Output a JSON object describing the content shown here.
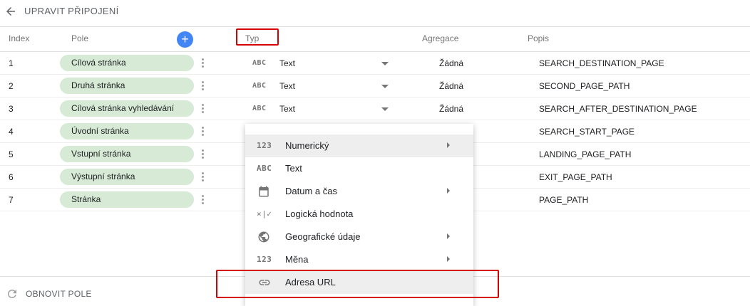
{
  "header": {
    "title": "UPRAVIT PŘIPOJENÍ"
  },
  "columns": {
    "index": "Index",
    "field": "Pole",
    "type": "Typ",
    "aggregation": "Agregace",
    "description": "Popis",
    "add_symbol": "+"
  },
  "rows": [
    {
      "index": "1",
      "field": "Cílová stránka",
      "type_icon": "ABC",
      "type": "Text",
      "aggregation": "Žádná",
      "description": "SEARCH_DESTINATION_PAGE"
    },
    {
      "index": "2",
      "field": "Druhá stránka",
      "type_icon": "ABC",
      "type": "Text",
      "aggregation": "Žádná",
      "description": "SECOND_PAGE_PATH"
    },
    {
      "index": "3",
      "field": "Cílová stránka vyhledávání",
      "type_icon": "ABC",
      "type": "Text",
      "aggregation": "Žádná",
      "description": "SEARCH_AFTER_DESTINATION_PAGE"
    },
    {
      "index": "4",
      "field": "Úvodní stránka",
      "description": "SEARCH_START_PAGE"
    },
    {
      "index": "5",
      "field": "Vstupní stránka",
      "description": "LANDING_PAGE_PATH"
    },
    {
      "index": "6",
      "field": "Výstupní stránka",
      "description": "EXIT_PAGE_PATH"
    },
    {
      "index": "7",
      "field": "Stránka",
      "description": "PAGE_PATH"
    }
  ],
  "type_menu": {
    "items": [
      {
        "icon": "123",
        "label": "Numerický",
        "submenu": true,
        "active": true
      },
      {
        "icon": "ABC",
        "label": "Text",
        "submenu": false
      },
      {
        "icon": "calendar-icon",
        "label": "Datum a čas",
        "submenu": true
      },
      {
        "icon": "×|✓",
        "label": "Logická hodnota",
        "submenu": false
      },
      {
        "icon": "globe-icon",
        "label": "Geografické údaje",
        "submenu": true
      },
      {
        "icon": "123",
        "label": "Měna",
        "submenu": true
      },
      {
        "icon": "link-icon",
        "label": "Adresa URL",
        "submenu": false
      }
    ]
  },
  "footer": {
    "refresh_label": "OBNOVIT POLE"
  },
  "colors": {
    "chip": "#d6ead5",
    "accent": "#4285f4",
    "highlight": "#d50000"
  }
}
